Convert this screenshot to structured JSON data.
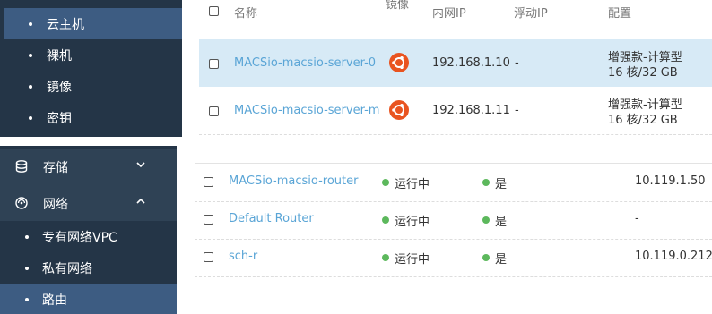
{
  "sidebar_top": {
    "items": [
      {
        "label": "云主机"
      },
      {
        "label": "裸机"
      },
      {
        "label": "镜像"
      },
      {
        "label": "密钥"
      }
    ]
  },
  "sidebar_bottom": {
    "storage": {
      "label": "存储"
    },
    "network": {
      "label": "网络"
    },
    "subitems": [
      {
        "label": "专有网络VPC"
      },
      {
        "label": "私有网络"
      },
      {
        "label": "路由"
      }
    ]
  },
  "server_table": {
    "columns": {
      "name": "名称",
      "image": "镜像",
      "private_ip": "内网IP",
      "floating_ip": "浮动IP",
      "config": "配置"
    },
    "rows": [
      {
        "name": "MACSio-macsio-server-0",
        "image_icon": "ubuntu-icon",
        "private_ip": "192.168.1.10",
        "floating_ip": "-",
        "config_type": "增强款-计算型",
        "config_spec": "16 核/32 GB"
      },
      {
        "name": "MACSio-macsio-server-m",
        "image_icon": "ubuntu-icon",
        "private_ip": "192.168.1.11",
        "floating_ip": "-",
        "config_type": "增强款-计算型",
        "config_spec": "16 核/32 GB"
      }
    ]
  },
  "router_table": {
    "rows": [
      {
        "name": "MACSio-macsio-router",
        "status": "运行中",
        "flag": "是",
        "ip": "10.119.1.50"
      },
      {
        "name": "Default Router",
        "status": "运行中",
        "flag": "是",
        "ip": "-"
      },
      {
        "name": "sch-r",
        "status": "运行中",
        "flag": "是",
        "ip": "10.119.0.212"
      }
    ]
  },
  "colors": {
    "sidebar_bg": "#243547",
    "sidebar_active": "#3d5c82",
    "link": "#5aa5d6",
    "row_selected": "#d7eaf6",
    "status_running": "#5cb85c",
    "ubuntu_orange": "#e95420"
  }
}
